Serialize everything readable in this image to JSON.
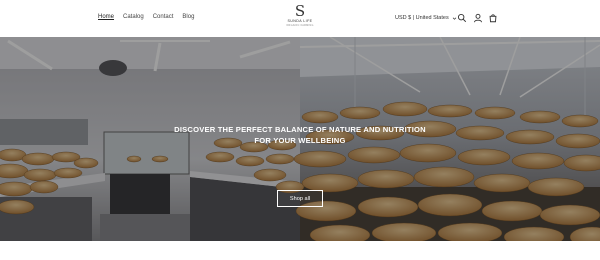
{
  "nav": {
    "home": "Home",
    "catalog": "Catalog",
    "contact": "Contact",
    "blog": "Blog"
  },
  "logo": {
    "mark": "S",
    "name": "SUNDA LIFE",
    "tagline": "ORGANIC FARMING"
  },
  "header": {
    "currency": "USD $ | United States",
    "icons": [
      "search-icon",
      "account-icon",
      "cart-icon"
    ]
  },
  "hero": {
    "heading": "DISCOVER THE PERFECT BALANCE OF NATURE AND NUTRITION FOR YOUR WELLBEING",
    "button_label": "Shop all"
  },
  "colors": {
    "overlay": "#000000",
    "text_on_hero": "#ffffff",
    "header_bg": "#ffffff"
  }
}
